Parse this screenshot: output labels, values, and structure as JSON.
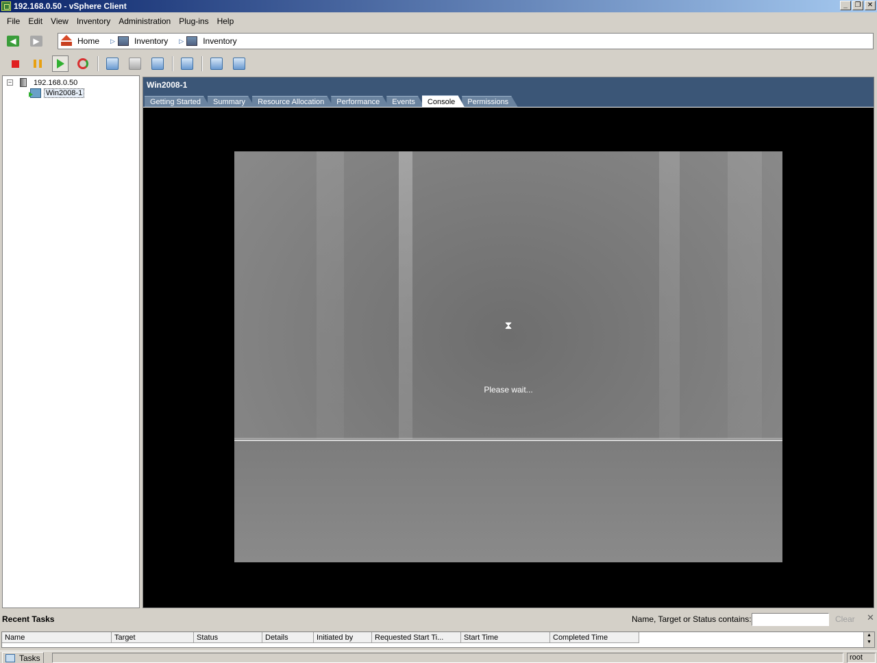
{
  "window": {
    "title": "192.168.0.50 - vSphere Client",
    "buttons": [
      "_",
      "❐",
      "✕"
    ]
  },
  "menu": [
    {
      "label": "File"
    },
    {
      "label": "Edit"
    },
    {
      "label": "View"
    },
    {
      "label": "Inventory"
    },
    {
      "label": "Administration"
    },
    {
      "label": "Plug-ins"
    },
    {
      "label": "Help"
    }
  ],
  "breadcrumb": {
    "home": "Home",
    "inventory_1": "Inventory",
    "inventory_2": "Inventory"
  },
  "tree": {
    "host": "192.168.0.50",
    "vm": "Win2008-1"
  },
  "main": {
    "title": "Win2008-1",
    "tabs": [
      {
        "label": "Getting Started"
      },
      {
        "label": "Summary"
      },
      {
        "label": "Resource Allocation"
      },
      {
        "label": "Performance"
      },
      {
        "label": "Events"
      },
      {
        "label": "Console"
      },
      {
        "label": "Permissions"
      }
    ],
    "active_tab": "Console",
    "console_message": "Please wait..."
  },
  "recent_tasks": {
    "title": "Recent Tasks",
    "filter_label": "Name, Target or Status contains: ▾",
    "filter_value": "",
    "clear_label": "Clear",
    "columns": [
      "Name",
      "Target",
      "Status",
      "Details",
      "Initiated by",
      "Requested Start Ti...",
      "Start Time",
      "Completed Time"
    ]
  },
  "statusbar": {
    "tasks_label": "Tasks",
    "user": "root"
  },
  "colors": {
    "header_bg": "#3b5677",
    "title_gradient_start": "#0a246a",
    "title_gradient_end": "#a6caf0"
  }
}
